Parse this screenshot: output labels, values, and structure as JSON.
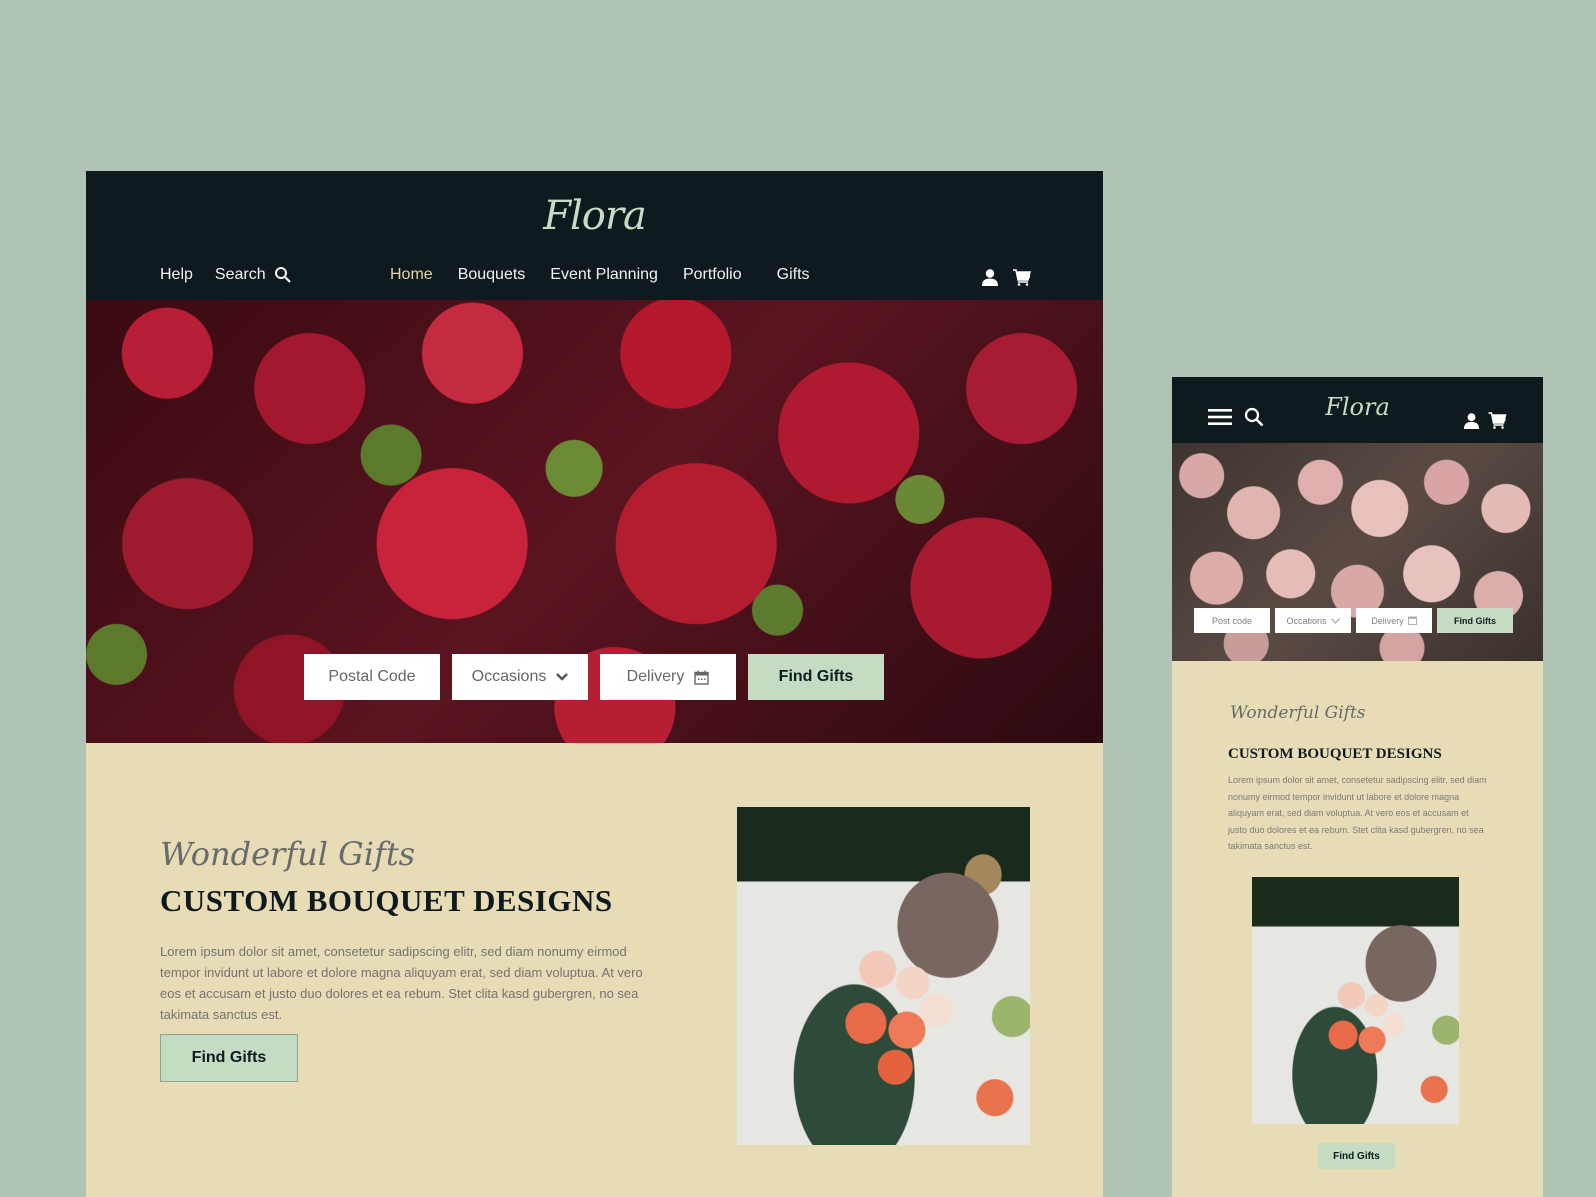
{
  "brand": {
    "name": "Flora",
    "colors": {
      "dark": "#0f1a1e",
      "accent": "#c4dcc4",
      "cream": "#e8dcb6",
      "active_nav": "#e6d2a8",
      "background": "#b0c4b5"
    }
  },
  "desktop": {
    "nav_left": {
      "help": "Help",
      "search": "Search"
    },
    "nav": [
      {
        "label": "Home",
        "active": true
      },
      {
        "label": "Bouquets"
      },
      {
        "label": "Event Planning"
      },
      {
        "label": "Portfolio"
      },
      {
        "label": "Gifts"
      }
    ],
    "icons": {
      "account": "user-icon",
      "cart": "cart-icon",
      "search": "search-icon",
      "calendar": "calendar-icon",
      "chevron": "chevron-down-icon"
    },
    "search_form": {
      "postal_placeholder": "Postal Code",
      "occasions_label": "Occasions",
      "delivery_label": "Delivery",
      "submit_label": "Find Gifts"
    },
    "section": {
      "script": "Wonderful Gifts",
      "title": "CUSTOM BOUQUET DESIGNS",
      "body": "Lorem ipsum dolor sit amet, consetetur sadipscing elitr, sed diam nonumy eirmod tempor invidunt ut labore et dolore magna aliquyam erat, sed diam voluptua. At vero eos et accusam et justo duo dolores et ea rebum. Stet clita kasd gubergren, no sea takimata sanctus est.",
      "cta": "Find Gifts"
    }
  },
  "mobile": {
    "icons": {
      "menu": "hamburger-icon",
      "search": "search-icon",
      "account": "user-icon",
      "cart": "cart-icon"
    },
    "search_form": {
      "postal_placeholder": "Post code",
      "occasions_label": "Occations",
      "delivery_label": "Delivery",
      "submit_label": "Find Gifts"
    },
    "section": {
      "script": "Wonderful Gifts",
      "title": "CUSTOM BOUQUET DESIGNS",
      "body": "Lorem ipsum dolor sit amet, consetetur sadipscing elitr, sed diam nonumy eirmod tempor invidunt ut labore et dolore magna aliquyam erat, sed diam voluptua. At vero eos et accusam et justo duo dolores et ea rebum. Stet clita kasd gubergren, no sea takimata sanctus est.",
      "cta": "Find Gifts"
    }
  }
}
